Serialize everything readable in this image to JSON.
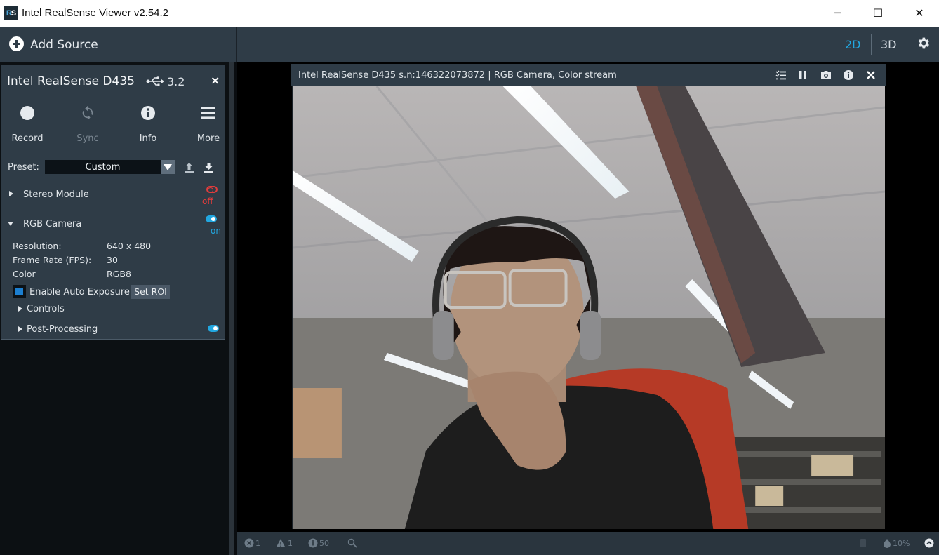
{
  "window": {
    "title": "Intel RealSense Viewer v2.54.2",
    "logo": {
      "r": "R",
      "s": "S"
    },
    "minimize_label": "─",
    "maximize_label": "☐",
    "close_label": "✕"
  },
  "toolbar": {
    "add_source_label": "Add Source",
    "mode_2d_label": "2D",
    "mode_3d_label": "3D",
    "active_mode": "2D",
    "accent_color": "#22a7e0"
  },
  "device": {
    "name": "Intel RealSense D435",
    "usb_version": "3.2",
    "close_label": "×",
    "actions": [
      {
        "label": "Record",
        "icon": "record-icon",
        "enabled": true
      },
      {
        "label": "Sync",
        "icon": "sync-icon",
        "enabled": false
      },
      {
        "label": "Info",
        "icon": "info-icon",
        "enabled": true
      },
      {
        "label": "More",
        "icon": "menu-icon",
        "enabled": true
      }
    ],
    "preset_label": "Preset:",
    "preset_value": "Custom",
    "stereo_module": {
      "label": "Stereo Module",
      "state": "off"
    },
    "rgb_camera": {
      "label": "RGB Camera",
      "state": "on",
      "properties": [
        {
          "key": "Resolution:",
          "value": "640 x 480"
        },
        {
          "key": "Frame Rate (FPS):",
          "value": "30"
        },
        {
          "key": "Color",
          "value": "RGB8"
        }
      ],
      "auto_exposure_label": "Enable Auto Exposure",
      "auto_exposure_checked": true,
      "set_roi_label": "Set ROI",
      "controls_label": "Controls",
      "post_processing_label": "Post-Processing",
      "post_processing_state": "on"
    }
  },
  "stream": {
    "title": "Intel RealSense D435 s.n:146322073872 | RGB Camera, Color stream"
  },
  "statusbar": {
    "errors": "1",
    "warnings": "1",
    "info": "50",
    "cpu": "10%"
  }
}
